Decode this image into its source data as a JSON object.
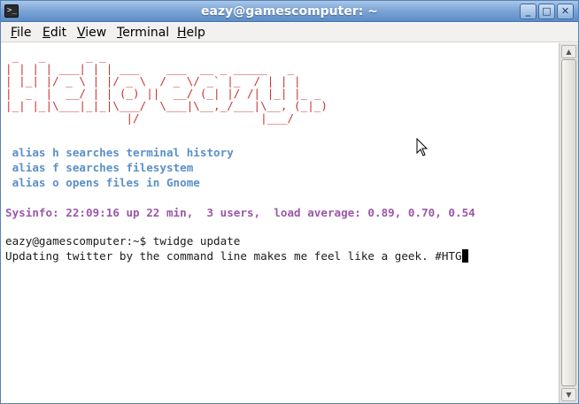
{
  "window": {
    "title": "eazy@gamescomputer: ~",
    "buttons": {
      "minimize": "_",
      "maximize": "□",
      "close": "✕"
    },
    "icon": "terminal-icon",
    "accent_color": "#7ea6d6"
  },
  "menubar": {
    "file": {
      "accel": "F",
      "rest": "ile"
    },
    "edit": {
      "accel": "E",
      "rest": "dit"
    },
    "view": {
      "accel": "V",
      "rest": "iew"
    },
    "terminal": {
      "accel": "T",
      "rest": "erminal"
    },
    "help": {
      "accel": "H",
      "rest": "elp"
    }
  },
  "terminal": {
    "banner_ascii": " _   _      _ _                                 \n| | | | ___| | | ___    ___  __ _ _____   _     \n| |_| |/ _ \\ | |/ _ \\  / _ \\/ _` |_  / | | |    \n|  _  |  __/ | | (_) ||  __/ (_| |/ /| |_| |_ _ \n|_| |_|\\___|_|_|\\___/  \\___|\\__,_/___|\\__, (_|_)\n                  |/                  |___/     ",
    "alias_lines": [
      " alias h searches terminal history",
      " alias f searches filesystem",
      " alias o opens files in Gnome"
    ],
    "sysinfo": "Sysinfo: 22:09:16 up 22 min,  3 users,  load average: 0.89, 0.70, 0.54",
    "prompt": "eazy@gamescomputer:~$ twidge update",
    "output": "Updating twitter by the command line makes me feel like a geek. #HTG",
    "colors": {
      "banner": "#cc3333",
      "alias": "#5b8fc9",
      "sysinfo": "#9a58a8",
      "text": "#1a1a1a"
    }
  },
  "scrollbar": {
    "up": "▲",
    "down": "▼"
  }
}
